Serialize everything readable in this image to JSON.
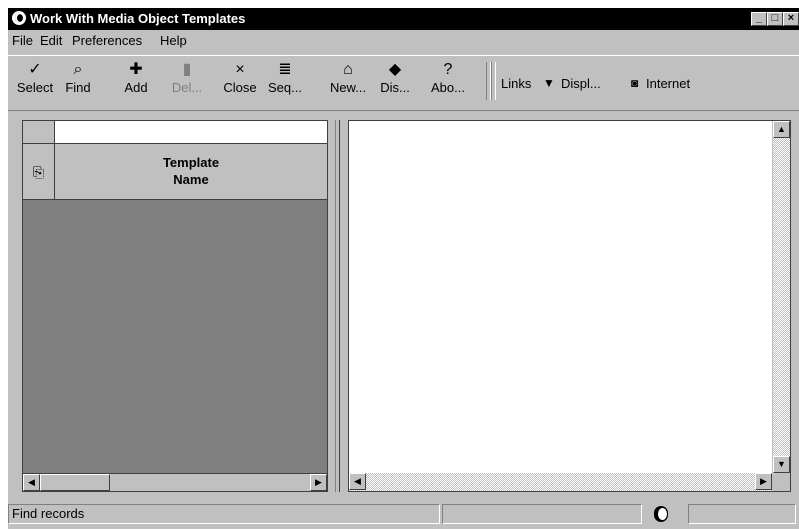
{
  "window": {
    "title": "Work With Media Object Templates"
  },
  "menu": [
    "File",
    "Edit",
    "Preferences",
    "Help"
  ],
  "toolbar": {
    "buttons": [
      {
        "label": "Select",
        "icon": "checkmark-icon"
      },
      {
        "label": "Find",
        "icon": "find-icon"
      },
      {
        "label": "Add",
        "icon": "plus-icon"
      },
      {
        "label": "Del...",
        "icon": "trash-icon",
        "disabled": true
      },
      {
        "label": "Close",
        "icon": "close-x-icon"
      },
      {
        "label": "Seq...",
        "icon": "sequence-icon"
      },
      {
        "label": "New...",
        "icon": "new-icon"
      },
      {
        "label": "Dis...",
        "icon": "display-icon"
      },
      {
        "label": "Abo...",
        "icon": "about-icon"
      }
    ],
    "links_label": "Links",
    "display_label": "Displ...",
    "internet_label": "Internet"
  },
  "grid": {
    "filter_value": "",
    "columns": [
      {
        "label_line1": "Template",
        "label_line2": "Name"
      }
    ],
    "rows": []
  },
  "statusbar": {
    "message": "Find records"
  }
}
